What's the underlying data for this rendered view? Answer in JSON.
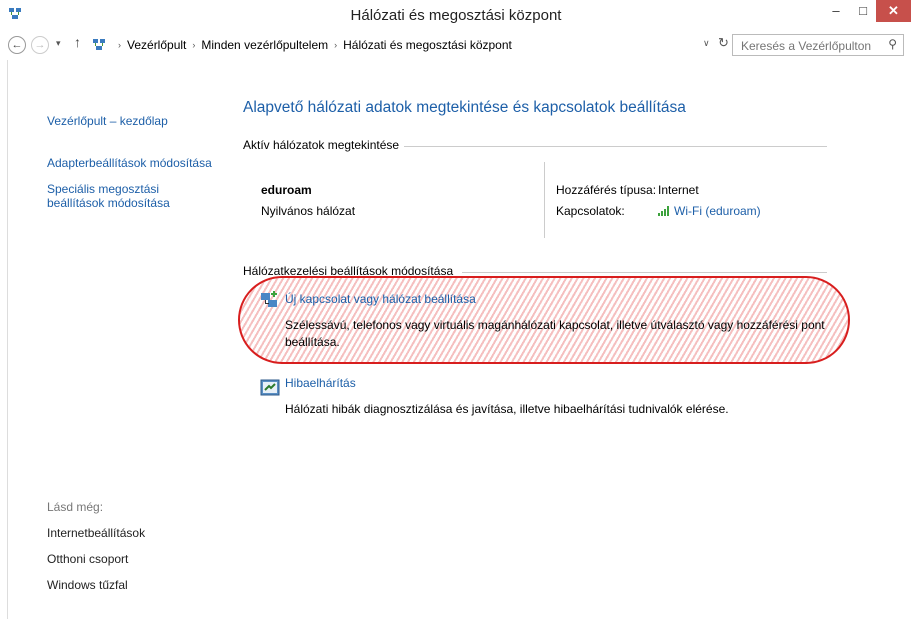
{
  "window": {
    "title": "Hálózati és megosztási központ",
    "minimize": "–",
    "maximize": "□",
    "close": "✕"
  },
  "nav": {
    "back": "←",
    "forward": "→",
    "history": "▾",
    "up": "↑"
  },
  "address": {
    "crumbs": [
      "Vezérlőpult",
      "Minden vezérlőpultelem",
      "Hálózati és megosztási központ"
    ],
    "separator": "›",
    "dropdown": "∨",
    "refresh": "↻"
  },
  "search": {
    "placeholder": "Keresés a Vezérlőpulton",
    "icon": "⚲"
  },
  "sidebar": {
    "home": "Vezérlőpult – kezdőlap",
    "adapter": "Adapterbeállítások módosítása",
    "sharing_line1": "Speciális megosztási",
    "sharing_line2": "beállítások módosítása",
    "see_also": "Lásd még:",
    "links": [
      "Internetbeállítások",
      "Otthoni csoport",
      "Windows tűzfal"
    ]
  },
  "main": {
    "title": "Alapvető hálózati adatok megtekintése és kapcsolatok beállítása",
    "active_header": "Aktív hálózatok megtekintése",
    "network": {
      "name": "eduroam",
      "type": "Nyilvános hálózat",
      "access_label": "Hozzáférés típusa:",
      "access_value": "Internet",
      "connections_label": "Kapcsolatok:",
      "connection_value": "Wi-Fi (eduroam)"
    },
    "change_header": "Hálózatkezelési beállítások módosítása",
    "tasks": [
      {
        "title": "Új kapcsolat vagy hálózat beállítása",
        "desc": "Szélessávú, telefonos vagy virtuális magánhálózati kapcsolat, illetve útválasztó vagy hozzáférési pont beállítása."
      },
      {
        "title": "Hibaelhárítás",
        "desc": "Hálózati hibák diagnosztizálása és javítása, illetve hibaelhárítási tudnivalók elérése."
      }
    ]
  },
  "colors": {
    "link": "#1d5fa8",
    "close_button": "#c7504b",
    "highlight": "#d81e1e"
  }
}
